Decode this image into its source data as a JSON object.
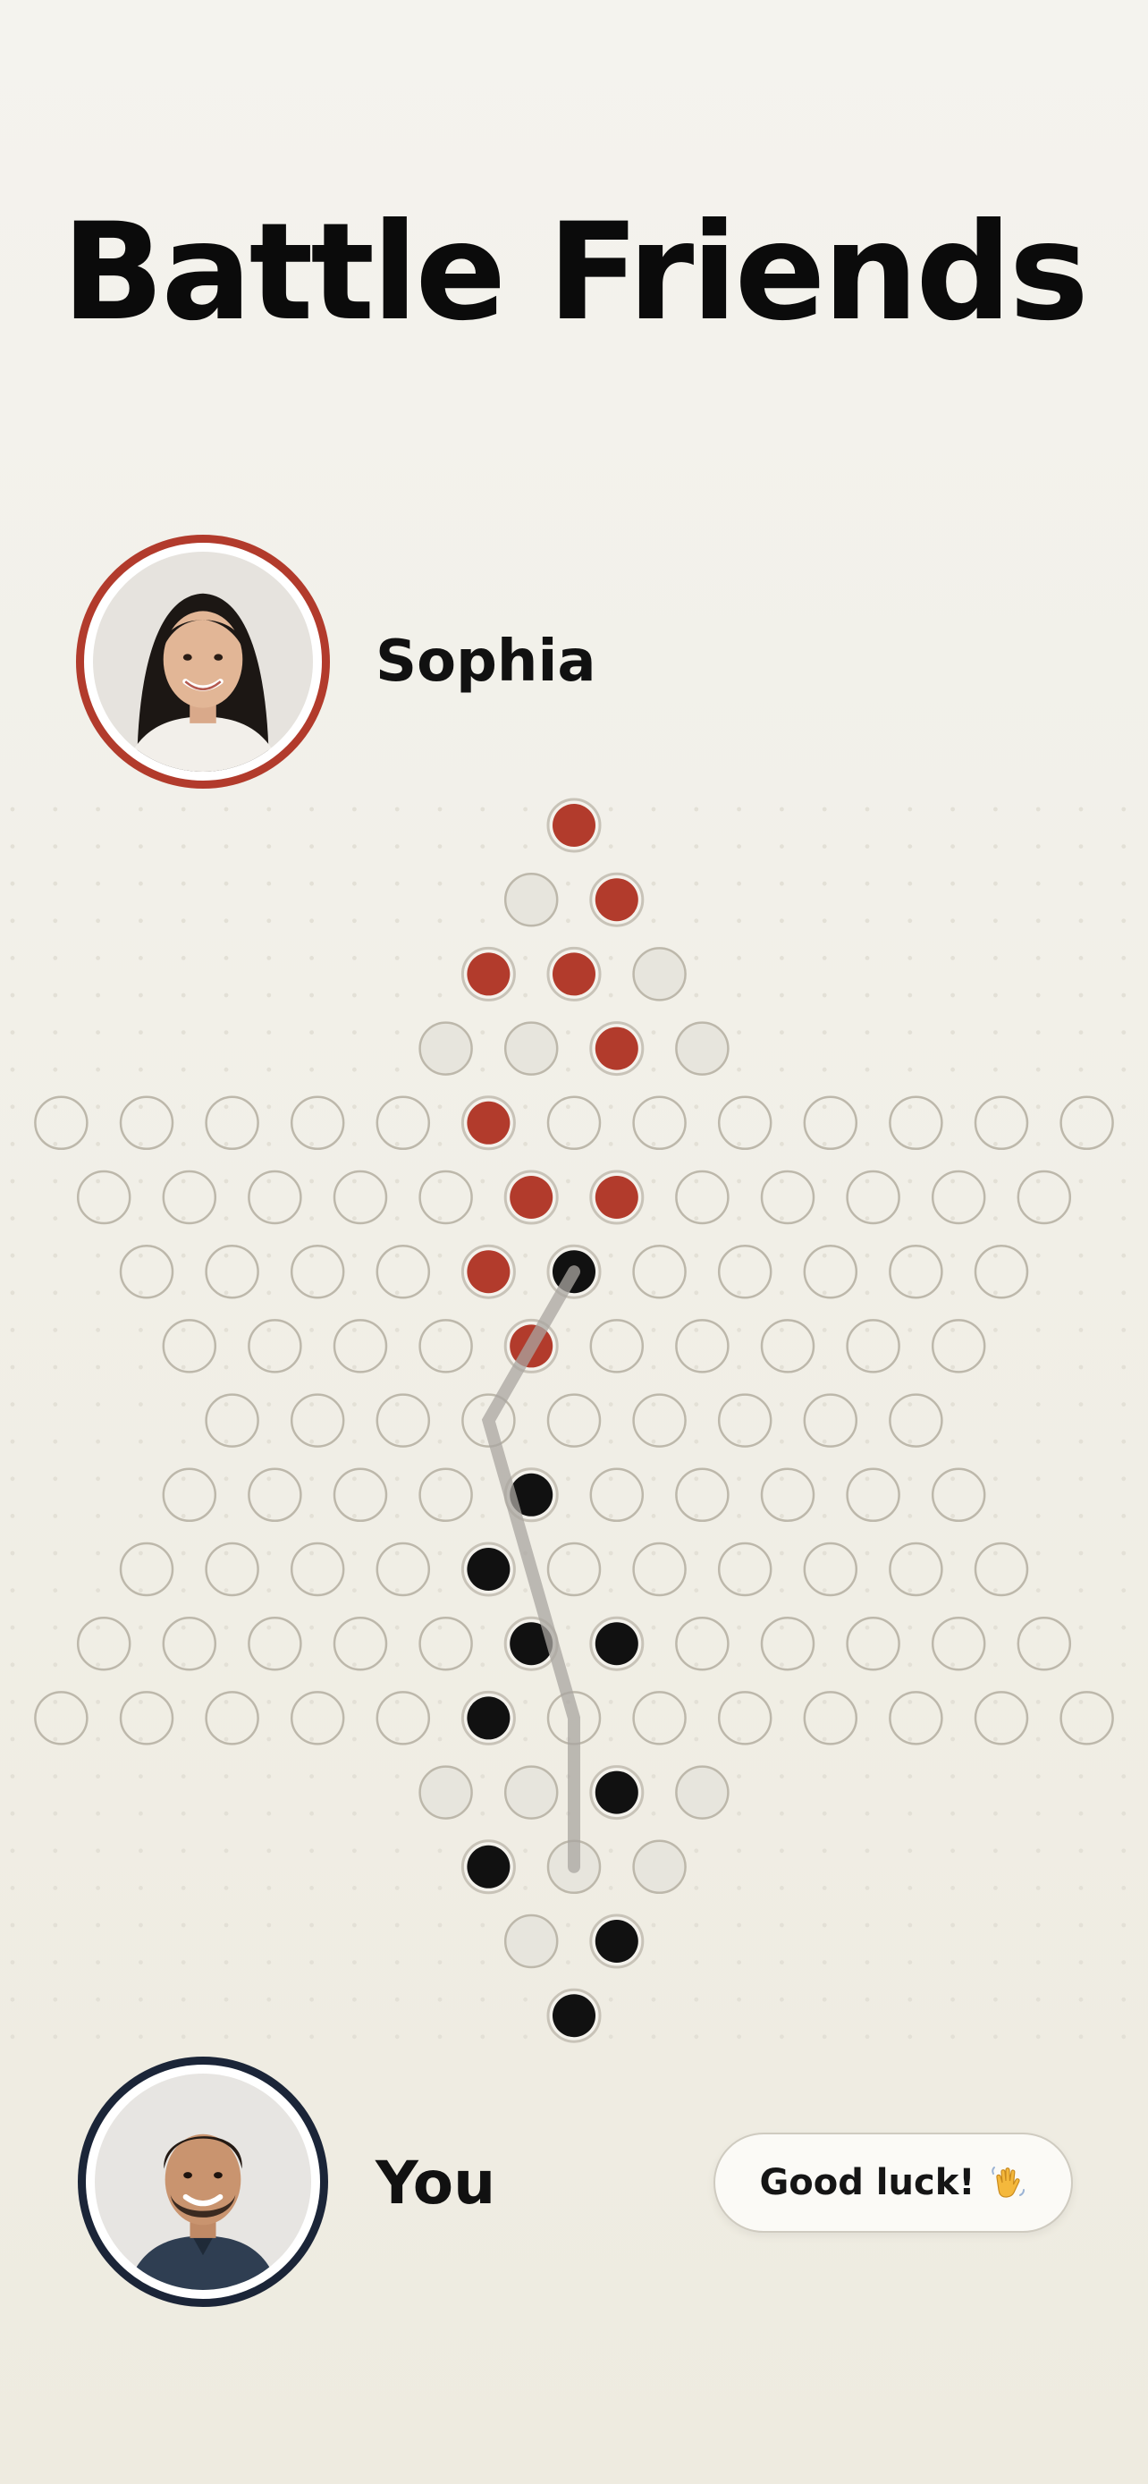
{
  "title": "Battle Friends",
  "opponent": {
    "name": "Sophia",
    "avatar": "opponent-portrait",
    "ring_color": "#b23b2c"
  },
  "player": {
    "name": "You",
    "avatar": "player-portrait",
    "ring_color": "#1b2538"
  },
  "chat_bubble": {
    "text": "Good luck!",
    "icon": "waving-hand-icon"
  },
  "colors": {
    "opponent_piece": "#b23b2c",
    "player_piece": "#111111",
    "empty_hole_stroke": "#bdb8ab",
    "move_path": "#a9a6a0"
  },
  "board": {
    "type": "chinese-checkers",
    "rows": [
      {
        "row": 0,
        "cells": [
          "R"
        ]
      },
      {
        "row": 1,
        "cells": [
          "f",
          "R"
        ]
      },
      {
        "row": 2,
        "cells": [
          "R",
          "R",
          "f"
        ]
      },
      {
        "row": 3,
        "cells": [
          "f",
          "f",
          "R",
          "f"
        ]
      },
      {
        "row": 4,
        "cells": [
          "e",
          "e",
          "e",
          "e",
          "e",
          "R",
          "e",
          "e",
          "e",
          "e",
          "e",
          "e",
          "e"
        ]
      },
      {
        "row": 5,
        "cells": [
          "e",
          "e",
          "e",
          "e",
          "e",
          "R",
          "R",
          "e",
          "e",
          "e",
          "e",
          "e"
        ]
      },
      {
        "row": 6,
        "cells": [
          "e",
          "e",
          "e",
          "e",
          "R",
          "B",
          "e",
          "e",
          "e",
          "e",
          "e"
        ]
      },
      {
        "row": 7,
        "cells": [
          "e",
          "e",
          "e",
          "e",
          "R",
          "e",
          "e",
          "e",
          "e",
          "e"
        ]
      },
      {
        "row": 8,
        "cells": [
          "e",
          "e",
          "e",
          "e",
          "e",
          "e",
          "e",
          "e",
          "e"
        ]
      },
      {
        "row": 9,
        "cells": [
          "e",
          "e",
          "e",
          "e",
          "B",
          "e",
          "e",
          "e",
          "e",
          "e"
        ]
      },
      {
        "row": 10,
        "cells": [
          "e",
          "e",
          "e",
          "e",
          "B",
          "e",
          "e",
          "e",
          "e",
          "e",
          "e"
        ]
      },
      {
        "row": 11,
        "cells": [
          "e",
          "e",
          "e",
          "e",
          "e",
          "B",
          "B",
          "e",
          "e",
          "e",
          "e",
          "e"
        ]
      },
      {
        "row": 12,
        "cells": [
          "e",
          "e",
          "e",
          "e",
          "e",
          "B",
          "e",
          "e",
          "e",
          "e",
          "e",
          "e",
          "e"
        ]
      },
      {
        "row": 13,
        "cells": [
          "f",
          "f",
          "B",
          "f"
        ]
      },
      {
        "row": 14,
        "cells": [
          "B",
          "f",
          "f"
        ]
      },
      {
        "row": 15,
        "cells": [
          "f",
          "B"
        ]
      },
      {
        "row": 16,
        "cells": [
          "B"
        ]
      }
    ],
    "move_path": [
      [
        6,
        5
      ],
      [
        8,
        3
      ],
      [
        12,
        6
      ],
      [
        14,
        1
      ]
    ],
    "legend": {
      "R": "opponent piece",
      "B": "player piece",
      "e": "empty hole",
      "f": "empty home-zone hole"
    }
  }
}
